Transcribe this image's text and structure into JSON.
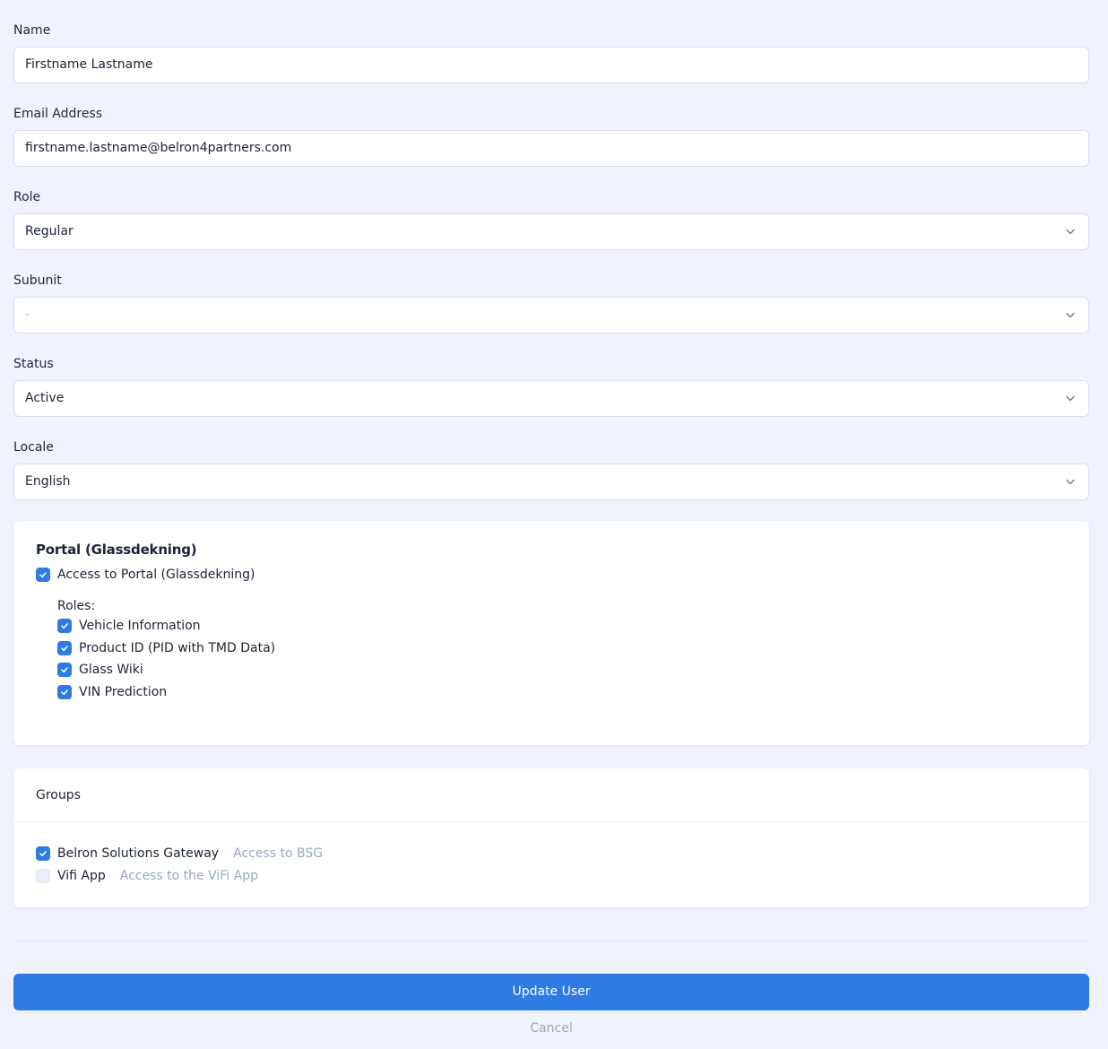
{
  "fields": {
    "name": {
      "label": "Name",
      "value": "Firstname Lastname"
    },
    "email": {
      "label": "Email Address",
      "value": "firstname.lastname@belron4partners.com"
    },
    "role": {
      "label": "Role",
      "value": "Regular"
    },
    "subunit": {
      "label": "Subunit",
      "value": "-"
    },
    "status": {
      "label": "Status",
      "value": "Active"
    },
    "locale": {
      "label": "Locale",
      "value": "English"
    }
  },
  "portal": {
    "title": "Portal (Glassdekning)",
    "access_label": "Access to Portal (Glassdekning)",
    "access_checked": true,
    "roles_label": "Roles:",
    "roles": [
      {
        "label": "Vehicle Information",
        "checked": true
      },
      {
        "label": "Product ID (PID with TMD Data)",
        "checked": true
      },
      {
        "label": "Glass Wiki",
        "checked": true
      },
      {
        "label": "VIN Prediction",
        "checked": true
      }
    ]
  },
  "groups": {
    "title": "Groups",
    "items": [
      {
        "label": "Belron Solutions Gateway",
        "description": "Access to BSG",
        "checked": true
      },
      {
        "label": "Vifi App",
        "description": "Access to the ViFi App",
        "checked": false
      }
    ]
  },
  "actions": {
    "update_label": "Update User",
    "cancel_label": "Cancel"
  },
  "colors": {
    "accent": "#2d7be3",
    "background": "#f0f3fd",
    "muted_text": "#98a6bf"
  },
  "icons": {
    "select_arrow": "chevron-down-icon",
    "check": "check-icon"
  }
}
